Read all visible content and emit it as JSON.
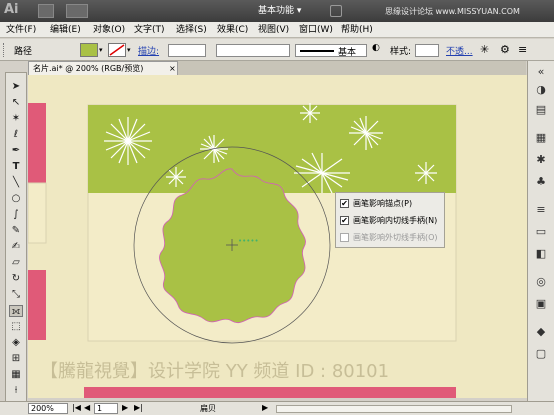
{
  "app": {
    "logo": "Ai",
    "workspace": "基本功能",
    "watermark_top": "思缘设计论坛 www.MISSYUAN.COM"
  },
  "menubar": {
    "items": [
      "文件(F)",
      "编辑(E)",
      "对象(O)",
      "文字(T)",
      "选择(S)",
      "效果(C)",
      "视图(V)",
      "窗口(W)",
      "帮助(H)"
    ]
  },
  "control": {
    "label": "路径",
    "fill_color": "#a9c145",
    "stroke_label": "描边:",
    "stroke_weight": "",
    "brush_label": "基本",
    "style_label": "样式:",
    "opacity_label": "不透..."
  },
  "document": {
    "tab_title": "名片.ai* @ 200% (RGB/预览)"
  },
  "status": {
    "zoom": "200%",
    "page": "1",
    "mode": "扁贝"
  },
  "popup": {
    "items": [
      {
        "label": "画笔影响锚点(P)",
        "checked": true,
        "enabled": true
      },
      {
        "label": "画笔影响内切线手柄(N)",
        "checked": true,
        "enabled": true
      },
      {
        "label": "画笔影响外切线手柄(O)",
        "checked": false,
        "enabled": false
      }
    ]
  },
  "canvas": {
    "card_top_color": "#a9c145",
    "card_bottom_color": "#f3ecc8",
    "accent_pink": "#e05a78",
    "watermark": "【騰龍視覺】设计学院  YY 频道 ID : 80101"
  }
}
